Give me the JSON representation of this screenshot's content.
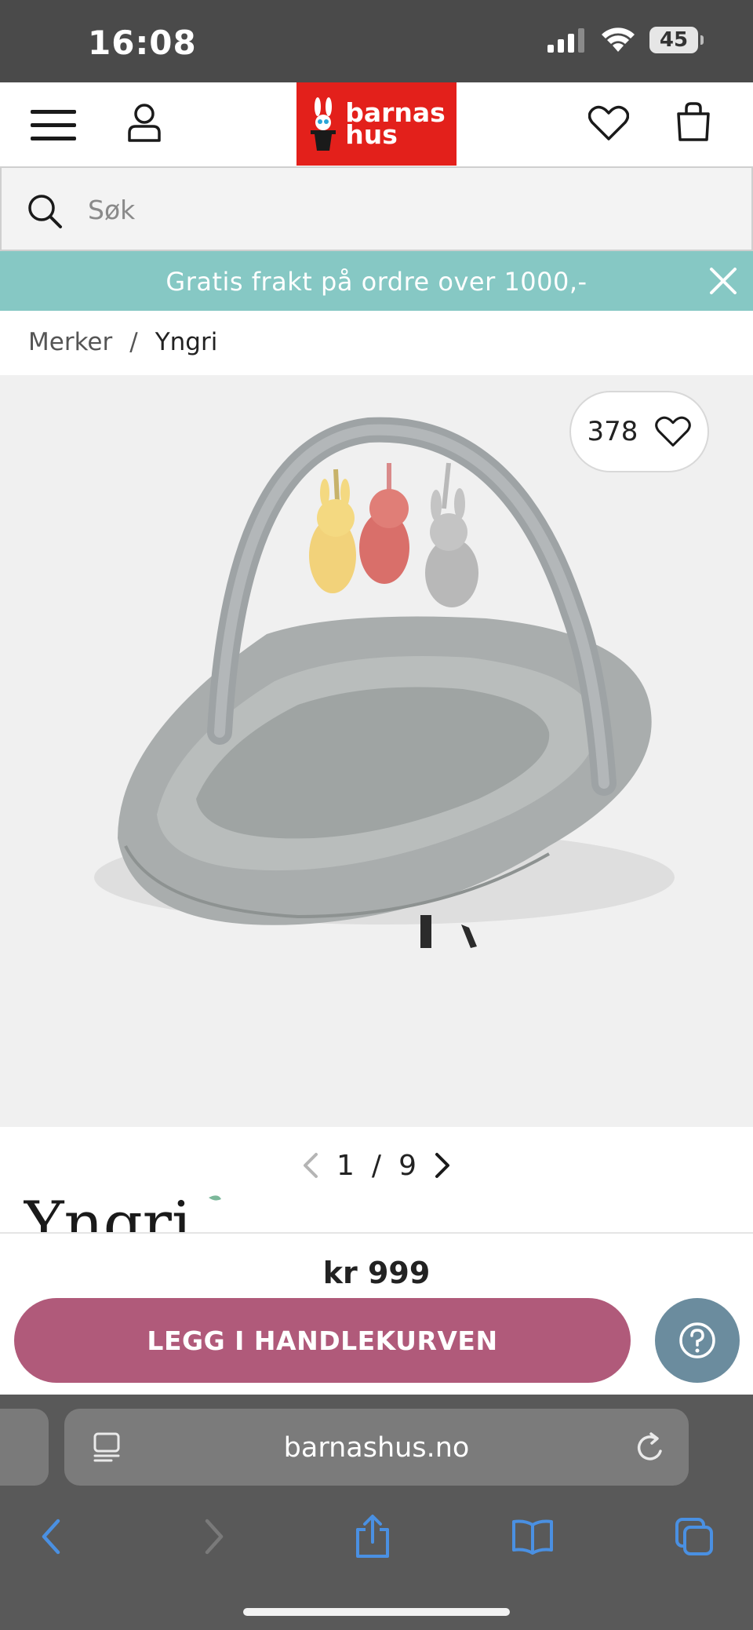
{
  "status_bar": {
    "time": "16:08",
    "battery": "45"
  },
  "header": {
    "logo_line1": "barnas",
    "logo_line2": "hus",
    "icons": [
      "menu-icon",
      "user-icon",
      "heart-icon",
      "shopping-bag-icon"
    ]
  },
  "search": {
    "placeholder": "Søk"
  },
  "promo": {
    "text": "Gratis frakt på ordre over 1000,-"
  },
  "breadcrumb": {
    "items": [
      "Merker",
      "Yngri"
    ],
    "separator": "/"
  },
  "product": {
    "like_count": "378",
    "image_index": "1",
    "image_total": "9",
    "pager_separator": "/",
    "brand": "Yngri",
    "price": "kr 999",
    "cart_button_label": "LEGG I HANDLEKURVEN"
  },
  "browser": {
    "url": "barnashus.no",
    "toolbar_icons": [
      "back-icon",
      "forward-icon",
      "share-icon",
      "bookmarks-icon",
      "tabs-icon"
    ]
  },
  "colors": {
    "status_bar": "#4a4a4a",
    "logo_red": "#e3201b",
    "promo_teal": "#86c8c4",
    "cart_button": "#b05a7a",
    "help_button": "#6b8c9e",
    "browser_accent": "#4a90e2"
  }
}
